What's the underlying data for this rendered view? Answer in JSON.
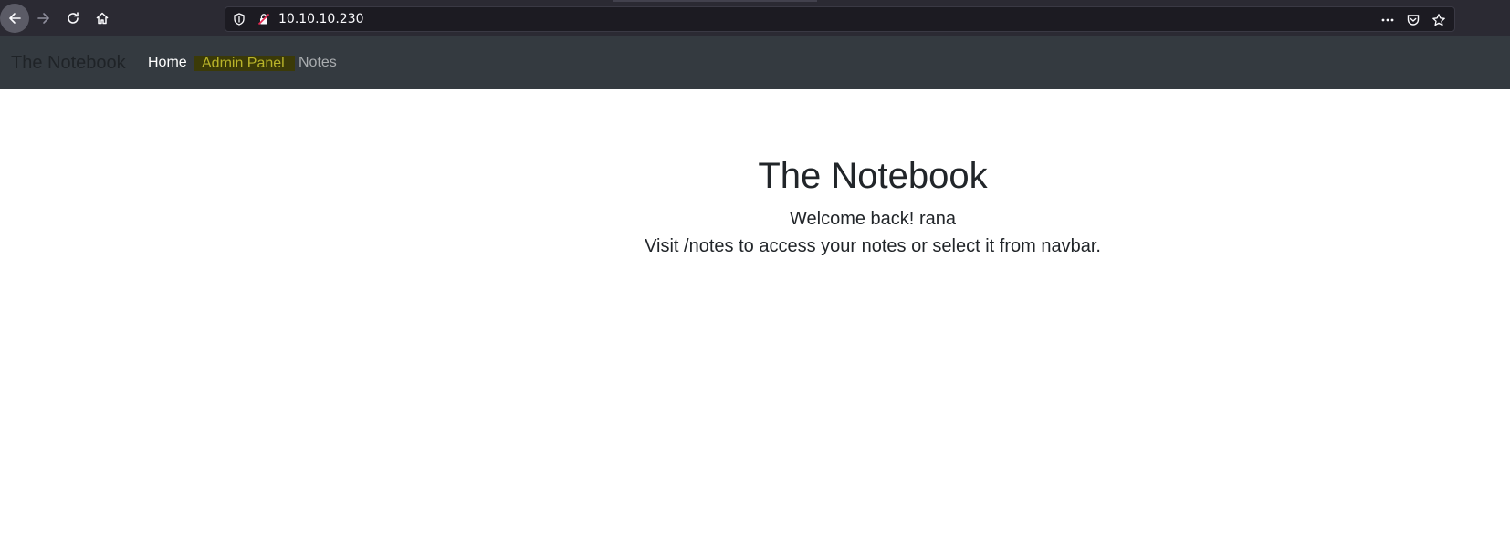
{
  "browser": {
    "url": "10.10.10.230",
    "icons": [
      "back-icon",
      "forward-icon",
      "reload-icon",
      "home-icon",
      "shield-icon",
      "insecure-lock-icon",
      "more-actions-icon",
      "pocket-icon",
      "bookmark-star-icon"
    ]
  },
  "navbar": {
    "brand": "The Notebook",
    "links": [
      {
        "label": "Home"
      },
      {
        "label": "Admin Panel"
      },
      {
        "label": "Notes"
      }
    ]
  },
  "main": {
    "title": "The Notebook",
    "welcome_prefix": "Welcome back!",
    "username": "rana",
    "instructions": "Visit /notes to access your notes or select it from navbar."
  },
  "colors": {
    "navbar_bg": "#343a40",
    "admin_highlight_bg": "#3b3a08",
    "admin_highlight_text": "#b9b42a",
    "text": "#212529"
  }
}
